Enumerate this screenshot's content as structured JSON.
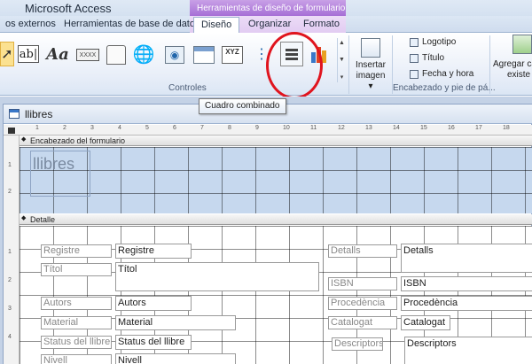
{
  "window": {
    "app_title": "Microsoft Access",
    "contextual_title": "Herramientas de diseño de formulario"
  },
  "tabs": {
    "externos": "os externos",
    "herramientas_bd": "Herramientas de base de datos",
    "diseno": "Diseño",
    "organizar": "Organizar",
    "formato": "Formato"
  },
  "ribbon": {
    "controls_group_label": "Controles",
    "hf_group_label": "Encabezado y pie de pá...",
    "controls": {
      "textbox_glyph": "ab|",
      "label_glyph": "Aa",
      "button_glyph": "XXXX",
      "optgroup_glyph": "XYZ"
    },
    "insert_image": {
      "line1": "Insertar",
      "line2": "imagen ▾"
    },
    "hf_items": {
      "logo": "Logotipo",
      "title": "Título",
      "datetime": "Fecha y hora"
    },
    "add_existing": {
      "line1": "Agregar ca",
      "line2": "existe"
    }
  },
  "tooltip": "Cuadro combinado",
  "document": {
    "tab_title": "llibres",
    "header_section": "Encabezado del formulario",
    "detail_section": "Detalle",
    "form_heading": "llibres"
  },
  "ruler": {
    "top": [
      "1",
      "2",
      "3",
      "4",
      "5",
      "6",
      "7",
      "8",
      "9",
      "10",
      "11",
      "12",
      "13",
      "14",
      "15",
      "16",
      "17",
      "18"
    ],
    "left_header": [
      "1",
      "2"
    ],
    "left_detail": [
      "1",
      "2",
      "3",
      "4"
    ]
  },
  "form_fields": {
    "registre": {
      "label": "Registre",
      "value": "Registre"
    },
    "titol": {
      "label": "Títol",
      "value": "Títol"
    },
    "autors": {
      "label": "Autors",
      "value": "Autors"
    },
    "material": {
      "label": "Material",
      "value": "Material"
    },
    "status": {
      "label": "Status del llibre",
      "value": "Status del llibre"
    },
    "nivell": {
      "label": "Nivell",
      "value": "Nivell"
    },
    "detalls": {
      "label": "Detalls",
      "value": "Detalls"
    },
    "isbn": {
      "label": "ISBN",
      "value": "ISBN"
    },
    "procedencia": {
      "label": "Procedència",
      "value": "Procedència"
    },
    "catalogat": {
      "label": "Catalogat",
      "value": "Catalogat"
    },
    "descriptors": {
      "label": "Descriptors",
      "value": "Descriptors"
    }
  },
  "colors": {
    "contextual_band": "#a66fd6",
    "highlight": "#e0141e",
    "header_section_fill": "#c6d8ee"
  }
}
